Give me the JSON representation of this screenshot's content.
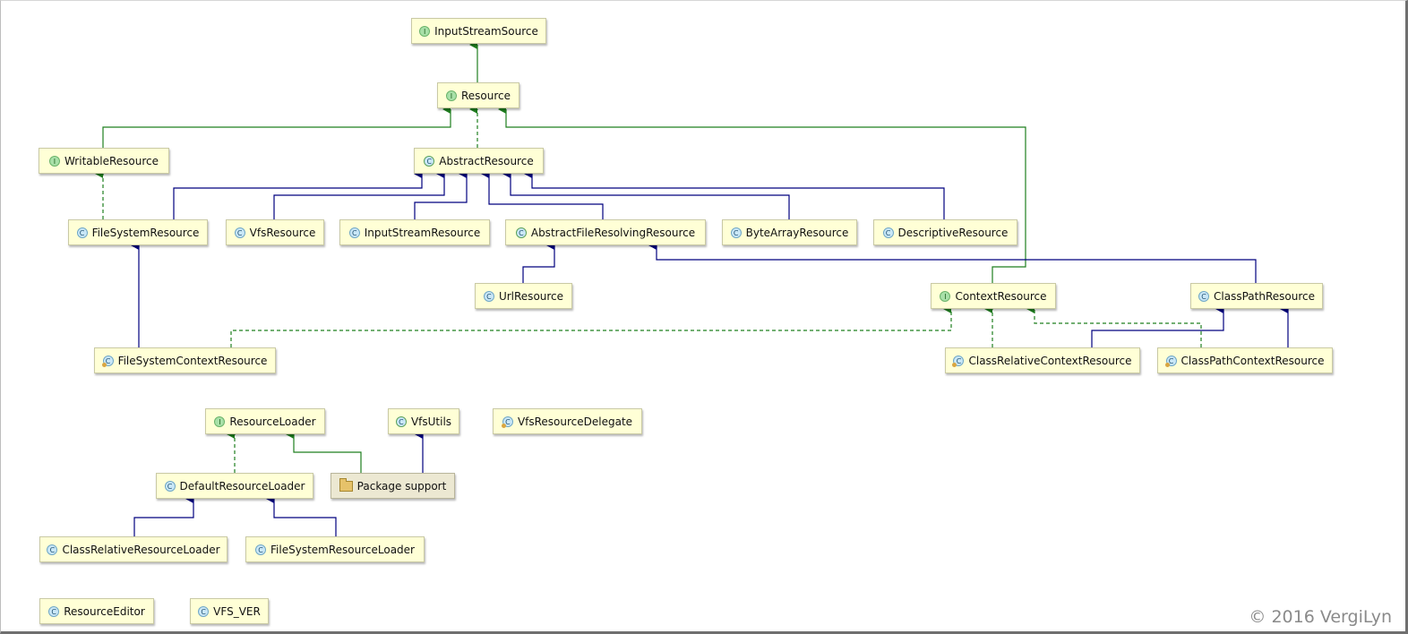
{
  "nodes": {
    "input_stream_source": {
      "label": "InputStreamSource",
      "kind": "interface"
    },
    "resource": {
      "label": "Resource",
      "kind": "interface"
    },
    "writable_resource": {
      "label": "WritableResource",
      "kind": "interface"
    },
    "abstract_resource": {
      "label": "AbstractResource",
      "kind": "abstract-class"
    },
    "file_system_resource": {
      "label": "FileSystemResource",
      "kind": "class"
    },
    "vfs_resource": {
      "label": "VfsResource",
      "kind": "class"
    },
    "input_stream_resource": {
      "label": "InputStreamResource",
      "kind": "class"
    },
    "abstract_file_resolving_resource": {
      "label": "AbstractFileResolvingResource",
      "kind": "abstract-class"
    },
    "byte_array_resource": {
      "label": "ByteArrayResource",
      "kind": "class"
    },
    "descriptive_resource": {
      "label": "DescriptiveResource",
      "kind": "class"
    },
    "url_resource": {
      "label": "UrlResource",
      "kind": "class"
    },
    "context_resource": {
      "label": "ContextResource",
      "kind": "interface"
    },
    "class_path_resource": {
      "label": "ClassPathResource",
      "kind": "class"
    },
    "file_system_context_resource": {
      "label": "FileSystemContextResource",
      "kind": "inner-class"
    },
    "class_relative_context_resource": {
      "label": "ClassRelativeContextResource",
      "kind": "inner-class"
    },
    "class_path_context_resource": {
      "label": "ClassPathContextResource",
      "kind": "inner-class"
    },
    "resource_loader": {
      "label": "ResourceLoader",
      "kind": "interface"
    },
    "vfs_utils": {
      "label": "VfsUtils",
      "kind": "abstract-class"
    },
    "vfs_resource_delegate": {
      "label": "VfsResourceDelegate",
      "kind": "inner-class"
    },
    "default_resource_loader": {
      "label": "DefaultResourceLoader",
      "kind": "class"
    },
    "package_support": {
      "label": "Package support",
      "kind": "package"
    },
    "class_relative_resource_loader": {
      "label": "ClassRelativeResourceLoader",
      "kind": "class"
    },
    "file_system_resource_loader": {
      "label": "FileSystemResourceLoader",
      "kind": "class"
    },
    "resource_editor": {
      "label": "ResourceEditor",
      "kind": "class"
    },
    "vfs_ver": {
      "label": "VFS_VER",
      "kind": "class"
    }
  },
  "badge_letters": {
    "interface": "I",
    "class": "C",
    "abstract-class": "C",
    "inner-class": "C"
  },
  "colors": {
    "extends_edge": "#00007f",
    "implements_edge": "#1f7f1f",
    "node_fill": "#ffffd6",
    "package_fill": "#ece8d2"
  },
  "copyright": "© 2016 VergiLyn"
}
